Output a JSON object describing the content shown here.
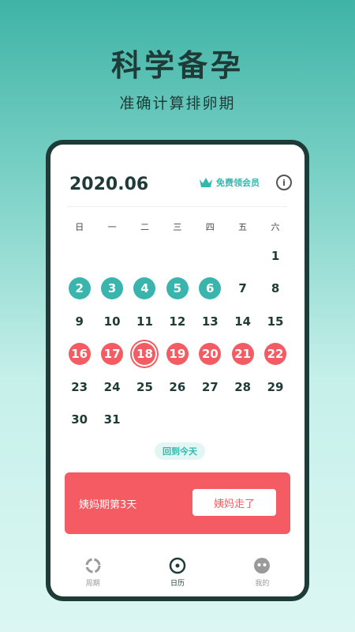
{
  "headline": "科学备孕",
  "subline": "准确计算排卵期",
  "header": {
    "month": "2020.06",
    "vip_label": "免费领会员",
    "info_icon": "info-icon"
  },
  "weekdays": [
    "日",
    "一",
    "二",
    "三",
    "四",
    "五",
    "六"
  ],
  "calendar": {
    "rows": [
      [
        "",
        "",
        "",
        "",
        "",
        "",
        "1"
      ],
      [
        "2",
        "3",
        "4",
        "5",
        "6",
        "7",
        "8"
      ],
      [
        "9",
        "10",
        "11",
        "12",
        "13",
        "14",
        "15"
      ],
      [
        "16",
        "17",
        "18",
        "19",
        "20",
        "21",
        "22"
      ],
      [
        "23",
        "24",
        "25",
        "26",
        "27",
        "28",
        "29"
      ],
      [
        "30",
        "31",
        "",
        "",
        "",
        "",
        ""
      ]
    ],
    "ovulation_days": [
      "2",
      "3",
      "4",
      "5",
      "6"
    ],
    "period_days": [
      "16",
      "17",
      "18",
      "19",
      "20",
      "21",
      "22"
    ],
    "today": "18"
  },
  "today_button": "回到今天",
  "period_card": {
    "status": "姨妈期第3天",
    "button": "姨妈走了"
  },
  "tabs": [
    {
      "label": "周期",
      "icon": "cycle-icon"
    },
    {
      "label": "日历",
      "icon": "calendar-dot-icon"
    },
    {
      "label": "我的",
      "icon": "face-icon"
    }
  ],
  "colors": {
    "teal": "#3ab5ad",
    "red": "#f45b62",
    "dark": "#1f3b37"
  }
}
